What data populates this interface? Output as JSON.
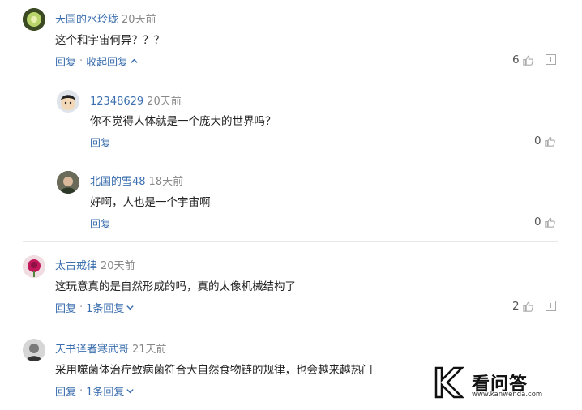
{
  "comments": [
    {
      "author": "天国的水玲珑",
      "time": "20天前",
      "text": "这个和宇宙何异？？？",
      "reply_label": "回复",
      "toggle_label": "收起回复",
      "likes": "6",
      "replies": [
        {
          "author": "12348629",
          "time": "20天前",
          "text": "你不觉得人体就是一个庞大的世界吗？",
          "reply_label": "回复",
          "likes": "0"
        },
        {
          "author": "北国的雪48",
          "time": "18天前",
          "text": "好啊，人也是一个宇宙啊",
          "reply_label": "回复",
          "likes": "0"
        }
      ]
    },
    {
      "author": "太古戒律",
      "time": "20天前",
      "text": "这玩意真的是自然形成的吗，真的太像机械结构了",
      "reply_label": "回复",
      "toggle_label": "1条回复",
      "likes": "2"
    },
    {
      "author": "天书译者寒武哥",
      "time": "21天前",
      "text": "采用噬菌体治疗致病菌符合大自然食物链的规律，也会越来越热门",
      "reply_label": "回复",
      "toggle_label": "1条回复"
    }
  ],
  "separator": "·",
  "watermark": {
    "title": "看问答",
    "url": "www.kanwenda.com"
  },
  "colors": {
    "link": "#3c6faf",
    "time": "#888888",
    "text": "#222222",
    "divider": "#e8e8e8"
  }
}
